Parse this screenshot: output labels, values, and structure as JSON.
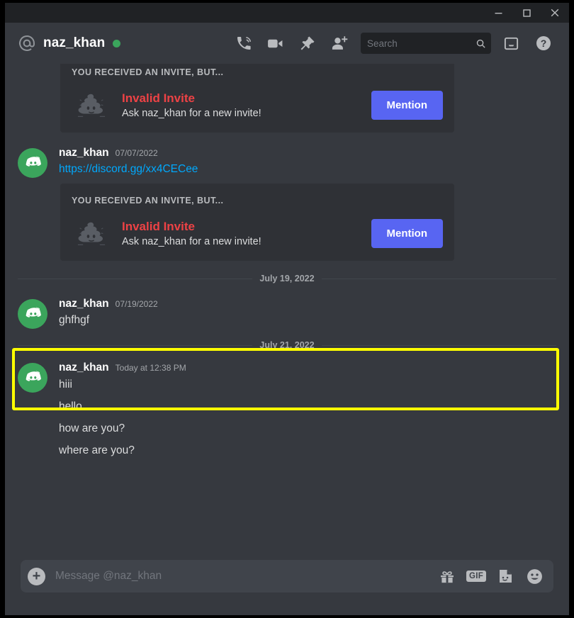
{
  "window": {
    "minimize_label": "minimize",
    "maximize_label": "maximize",
    "close_label": "close"
  },
  "header": {
    "dm_name": "naz_khan",
    "status": "online",
    "icons": [
      "call-icon",
      "video-call-icon",
      "pinned-messages-icon",
      "add-friend-icon",
      "inbox-icon",
      "help-icon"
    ],
    "search": {
      "placeholder": "Search"
    }
  },
  "messages": [
    {
      "type": "embed",
      "title": "YOU RECEIVED AN INVITE, BUT...",
      "invalid_title": "Invalid Invite",
      "invalid_sub": "Ask naz_khan for a new invite!",
      "button": "Mention"
    },
    {
      "type": "message",
      "author": "naz_khan",
      "timestamp": "07/07/2022",
      "link": "https://discord.gg/xx4CECee"
    },
    {
      "type": "embed",
      "title": "YOU RECEIVED AN INVITE, BUT...",
      "invalid_title": "Invalid Invite",
      "invalid_sub": "Ask naz_khan for a new invite!",
      "button": "Mention"
    }
  ],
  "divider_1": "July 19, 2022",
  "highlighted_message": {
    "author": "naz_khan",
    "timestamp": "07/19/2022",
    "text": "ghfhgf"
  },
  "divider_2": "July 21, 2022",
  "last_group": {
    "author": "naz_khan",
    "timestamp": "Today at 12:38 PM",
    "lines": [
      "hiii",
      "hello",
      "how are you?",
      "where are you?"
    ]
  },
  "composer": {
    "placeholder": "Message @naz_khan",
    "value": "",
    "icons": [
      "gift-icon",
      "gif-icon",
      "sticker-icon",
      "emoji-icon"
    ],
    "gif_label": "GIF"
  },
  "colors": {
    "app_background": "#36393f",
    "embed_background": "#2f3136",
    "titlebar": "#202225",
    "accent_blurple": "#5865f2",
    "danger_red": "#ed4245",
    "link_blue": "#00a8fc",
    "online_green": "#3ba55c",
    "highlight_yellow": "#ffff00"
  }
}
